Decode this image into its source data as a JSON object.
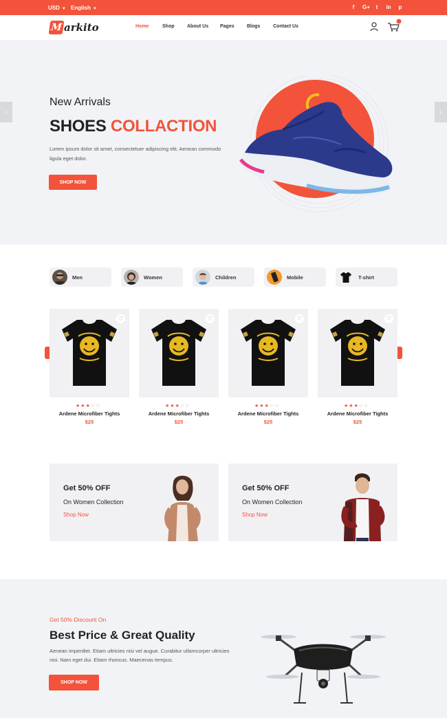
{
  "topbar": {
    "currency": "USD",
    "language": "English",
    "social": [
      {
        "icon": "facebook-icon",
        "glyph": "f"
      },
      {
        "icon": "google-plus-icon",
        "glyph": "G+"
      },
      {
        "icon": "twitter-icon",
        "glyph": "t"
      },
      {
        "icon": "linkedin-icon",
        "glyph": "in"
      },
      {
        "icon": "pinterest-icon",
        "glyph": "p"
      }
    ]
  },
  "header": {
    "logo_initial": "M",
    "logo_rest": "arkito",
    "nav": [
      "Home",
      "Shop",
      "About Us",
      "Pages",
      "Blogs",
      "Contact Us"
    ],
    "active_nav": "Home"
  },
  "hero": {
    "subtitle": "New Arrivals",
    "title_part1": "SHOES",
    "title_part2": "COLLACTION",
    "text": "Lorem ipsum dolor sit amet, consectetuer adipiscing elit. Aenean commodo ligula eget dolor.",
    "button": "SHOP NOW",
    "prev_glyph": "‹",
    "next_glyph": "›"
  },
  "categories": [
    {
      "label": "Men",
      "icon": "men-avatar-icon"
    },
    {
      "label": "Women",
      "icon": "women-avatar-icon"
    },
    {
      "label": "Children",
      "icon": "children-avatar-icon"
    },
    {
      "label": "Mobile",
      "icon": "mobile-icon"
    },
    {
      "label": "T-shirt",
      "icon": "tshirt-icon"
    }
  ],
  "products": [
    {
      "name": "Ardene Microfiber Tights",
      "price": "$25",
      "rating": 3
    },
    {
      "name": "Ardene Microfiber Tights",
      "price": "$25",
      "rating": 3
    },
    {
      "name": "Ardene Microfiber Tights",
      "price": "$25",
      "rating": 3
    },
    {
      "name": "Ardene Microfiber Tights",
      "price": "$25",
      "rating": 3
    }
  ],
  "product_arrows": {
    "prev": "‹",
    "next": "›"
  },
  "promos": [
    {
      "heading": "Get 50% OFF",
      "sub": "On Women Collection",
      "link": "Shop Now"
    },
    {
      "heading": "Get 50% OFF",
      "sub": "On Women Collection",
      "link": "Shop Now"
    }
  ],
  "bottom": {
    "kicker": "Get 50% Discount On",
    "title": "Best Price & Great Quality",
    "text": "Aenean imperdiet. Etiam ultricies nisi vel augue. Curabitur ullamcorper ultricies nisi. Nam eget dui. Etiam rhoncus. Maecenas tempus.",
    "button": "SHOP NOW"
  },
  "colors": {
    "accent": "#f2533a",
    "panel": "#f1f1f4",
    "section": "#f2f3f6"
  }
}
